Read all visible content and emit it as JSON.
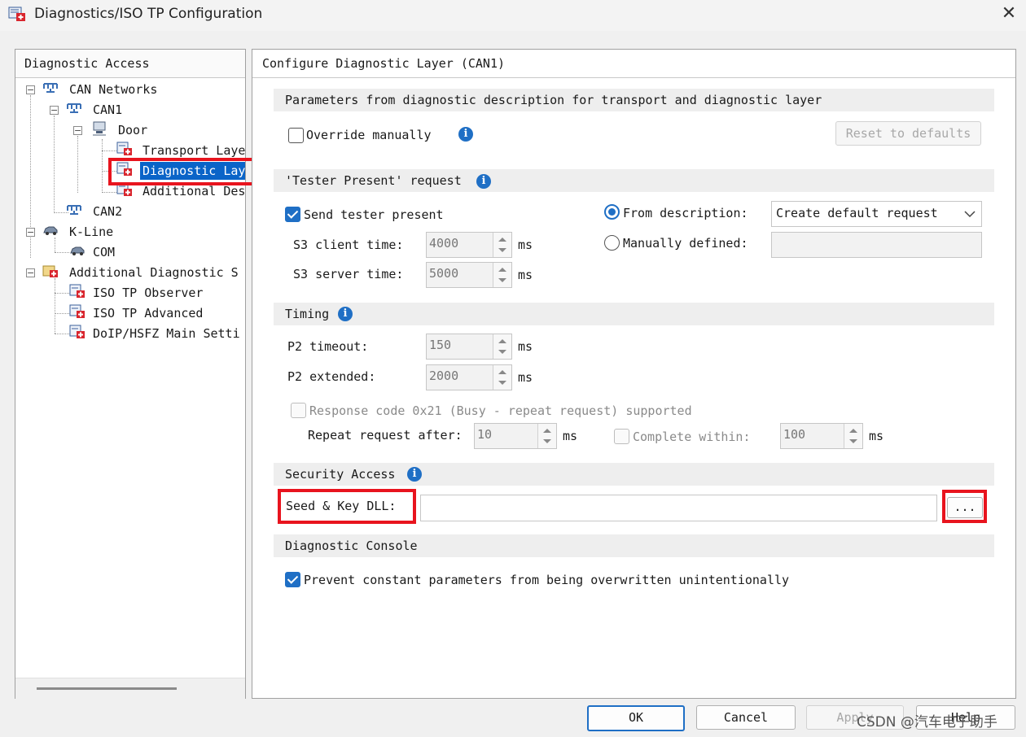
{
  "window": {
    "title": "Diagnostics/ISO TP Configuration",
    "close_glyph": "✕"
  },
  "left": {
    "header": "Diagnostic Access",
    "tree": {
      "can_networks": "CAN Networks",
      "can1": "CAN1",
      "door": "Door",
      "transport": "Transport Laye",
      "diagnostic": "Diagnostic Lay",
      "additional_des": "Additional Des",
      "can2": "CAN2",
      "kline": "K-Line",
      "com": "COM",
      "additional_diag": "Additional Diagnostic S",
      "isotp_observer": "ISO TP Observer",
      "isotp_advanced": "ISO TP Advanced",
      "doip": "DoIP/HSFZ Main Setti"
    }
  },
  "right": {
    "header": "Configure Diagnostic Layer (CAN1)",
    "params": {
      "title": "Parameters from diagnostic description for transport and diagnostic layer",
      "override_label": "Override manually",
      "override_checked": false,
      "reset_label": "Reset to defaults"
    },
    "tester": {
      "title": "'Tester Present' request",
      "send_label": "Send tester present",
      "send_checked": true,
      "s3_client_label": "S3 client time:",
      "s3_client_value": "4000",
      "s3_server_label": "S3 server time:",
      "s3_server_value": "5000",
      "unit": "ms",
      "from_desc_label": "From description:",
      "from_desc_selected": true,
      "from_desc_value": "Create default request",
      "manual_label": "Manually defined:",
      "manual_value": ""
    },
    "timing": {
      "title": "Timing",
      "p2_timeout_label": "P2 timeout:",
      "p2_timeout_value": "150",
      "p2_extended_label": "P2 extended:",
      "p2_extended_value": "2000",
      "unit": "ms",
      "response_label": "Response code 0x21 (Busy - repeat request) supported",
      "repeat_label": "Repeat request after:",
      "repeat_value": "10",
      "complete_label": "Complete within:",
      "complete_value": "100"
    },
    "security": {
      "title": "Security Access",
      "seed_label": "Seed & Key DLL:",
      "seed_value": "",
      "browse_label": "..."
    },
    "console": {
      "title": "Diagnostic Console",
      "prevent_label": "Prevent constant parameters from being overwritten unintentionally",
      "prevent_checked": true
    }
  },
  "buttons": {
    "ok": "OK",
    "cancel": "Cancel",
    "apply": "Apply",
    "help": "Help"
  },
  "watermark": "CSDN @汽车电子助手",
  "colors": {
    "accent": "#1f6fc5",
    "highlight_box": "#e8141e",
    "selection": "#0a64c8"
  }
}
